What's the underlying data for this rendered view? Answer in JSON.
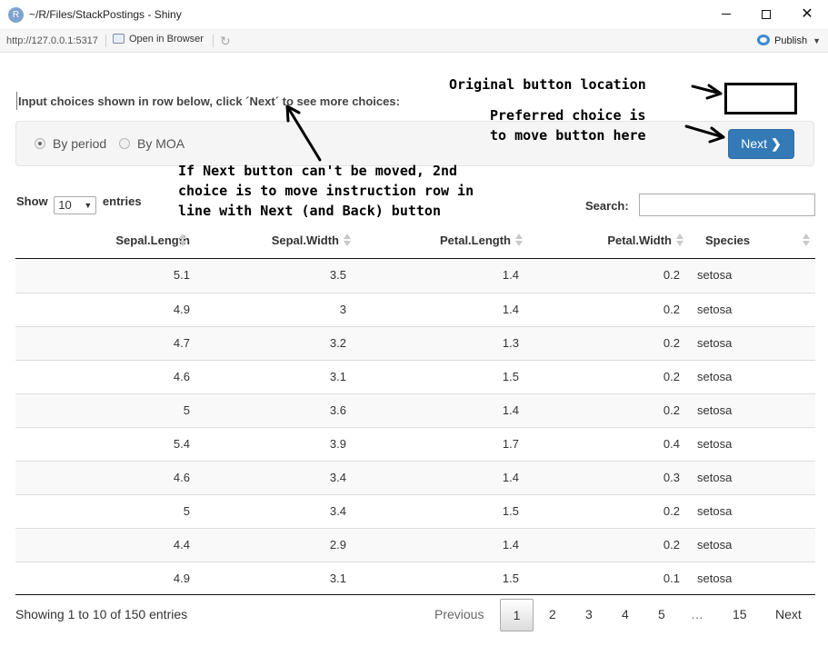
{
  "window": {
    "app_icon_letter": "R",
    "title": "~/R/Files/StackPostings - Shiny",
    "min_glyph": "",
    "max_glyph": "",
    "close_glyph": "✕"
  },
  "address": {
    "url": "http://127.0.0.1:5317",
    "open_in_browser": "Open in Browser",
    "publish": "Publish"
  },
  "app": {
    "instructions": "Input choices shown in row below, click ´Next´ to see more choices:",
    "radios": [
      {
        "label": "By period",
        "checked": true
      },
      {
        "label": "By MOA",
        "checked": false
      }
    ],
    "next_button": "Next"
  },
  "annotations": {
    "original_location": "Original button location",
    "preferred": "Preferred choice is\nto move button here",
    "second_choice": "If Next button can't be moved, 2nd\nchoice is to move instruction row in\nline with Next (and Back) button"
  },
  "datatable": {
    "show_label": "Show",
    "entries_value": "10",
    "entries_label": "entries",
    "search_label": "Search:",
    "columns": [
      "Sepal.Length",
      "Sepal.Width",
      "Petal.Length",
      "Petal.Width",
      "Species"
    ],
    "rows": [
      [
        "5.1",
        "3.5",
        "1.4",
        "0.2",
        "setosa"
      ],
      [
        "4.9",
        "3",
        "1.4",
        "0.2",
        "setosa"
      ],
      [
        "4.7",
        "3.2",
        "1.3",
        "0.2",
        "setosa"
      ],
      [
        "4.6",
        "3.1",
        "1.5",
        "0.2",
        "setosa"
      ],
      [
        "5",
        "3.6",
        "1.4",
        "0.2",
        "setosa"
      ],
      [
        "5.4",
        "3.9",
        "1.7",
        "0.4",
        "setosa"
      ],
      [
        "4.6",
        "3.4",
        "1.4",
        "0.3",
        "setosa"
      ],
      [
        "5",
        "3.4",
        "1.5",
        "0.2",
        "setosa"
      ],
      [
        "4.4",
        "2.9",
        "1.4",
        "0.2",
        "setosa"
      ],
      [
        "4.9",
        "3.1",
        "1.5",
        "0.1",
        "setosa"
      ]
    ],
    "info": "Showing 1 to 10 of 150 entries",
    "pagination": {
      "previous": "Previous",
      "pages": [
        "1",
        "2",
        "3",
        "4",
        "5",
        "…",
        "15"
      ],
      "current": "1",
      "next": "Next"
    }
  }
}
